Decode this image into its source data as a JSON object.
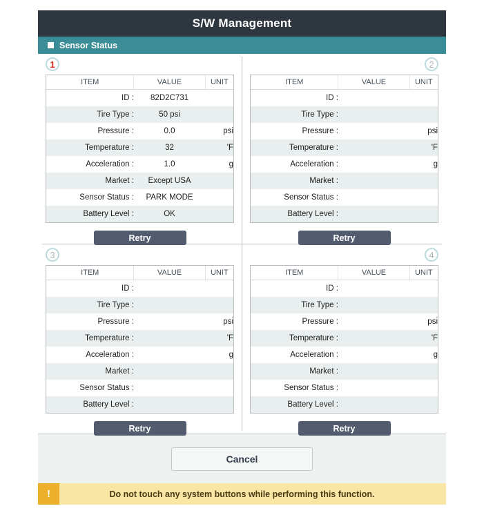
{
  "header": {
    "title": "S/W Management",
    "section_label": "Sensor Status",
    "bullet_icon": "square-bullet-icon"
  },
  "table": {
    "columns": [
      "ITEM",
      "VALUE",
      "UNIT"
    ],
    "row_labels": [
      "ID :",
      "Tire Type :",
      "Pressure :",
      "Temperature :",
      "Acceleration :",
      "Market :",
      "Sensor Status :",
      "Battery Level :"
    ],
    "units": [
      "",
      "",
      "psi",
      "'F",
      "g",
      "",
      "",
      ""
    ]
  },
  "panels": [
    {
      "number": "1",
      "state": "active",
      "retry_label": "Retry",
      "values": [
        "82D2C731",
        "50 psi",
        "0.0",
        "32",
        "1.0",
        "Except USA",
        "PARK MODE",
        "OK"
      ]
    },
    {
      "number": "2",
      "state": "inactive",
      "retry_label": "Retry",
      "values": [
        "",
        "",
        "",
        "",
        "",
        "",
        "",
        ""
      ]
    },
    {
      "number": "3",
      "state": "inactive",
      "retry_label": "Retry",
      "values": [
        "",
        "",
        "",
        "",
        "",
        "",
        "",
        ""
      ]
    },
    {
      "number": "4",
      "state": "inactive",
      "retry_label": "Retry",
      "values": [
        "",
        "",
        "",
        "",
        "",
        "",
        "",
        ""
      ]
    }
  ],
  "footer": {
    "cancel_label": "Cancel",
    "warning_icon": "exclamation-icon",
    "warning_symbol": "!",
    "warning_text": "Do not touch any system buttons while performing this function."
  },
  "colors": {
    "title_bar": "#2E3740",
    "sub_bar": "#3A8C96",
    "active_badge": "#D52B1E",
    "inactive_badge": "#ADB5B8",
    "retry_button": "#535C6E",
    "warning_bg": "#F9E5A4",
    "warning_icon_bg": "#ECAE2B",
    "row_stripe": "#E9EFEF"
  }
}
